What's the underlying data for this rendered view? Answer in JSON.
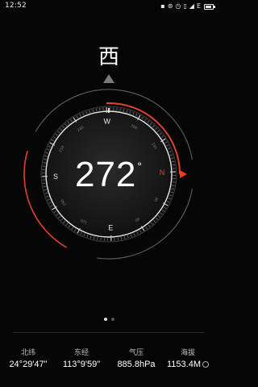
{
  "status_bar": {
    "time": "12:52",
    "icons": [
      "signal-icon",
      "sync-icon",
      "alarm-icon",
      "vibrate-icon",
      "cellular-icon",
      "network-icon",
      "battery-icon"
    ],
    "network_label": "E",
    "battery_level": 0.8
  },
  "compass": {
    "direction_char": "西",
    "heading_value": "272",
    "degree_symbol": "°",
    "cardinals": {
      "north": "N",
      "east": "E",
      "south": "S",
      "west": "W"
    },
    "scale_labels": [
      "30",
      "60",
      "120",
      "150",
      "210",
      "240",
      "300",
      "330"
    ],
    "accent_color": "#e0432c",
    "indicator_color": "#ff3b1e"
  },
  "pager": {
    "count": 2,
    "active_index": 0
  },
  "info": {
    "latitude_label": "北纬",
    "latitude_value": "24°29'47\"",
    "longitude_label": "东经",
    "longitude_value": "113°9'59\"",
    "pressure_label": "气压",
    "pressure_value": "885.8hPa",
    "altitude_label": "海拔",
    "altitude_value": "1153.4M"
  }
}
